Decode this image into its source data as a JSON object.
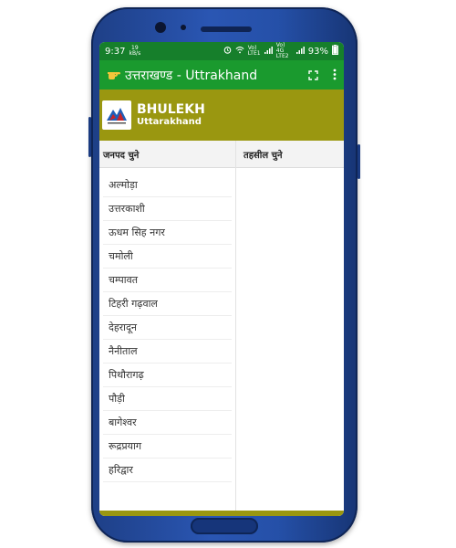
{
  "status": {
    "time": "9:37",
    "speed_value": "19",
    "speed_unit": "kB/s",
    "net1_label": "Vo) LTE1",
    "net2_label": "Vo) 4G LTE2",
    "battery": "93%"
  },
  "appbar": {
    "title": "उत्तराखण्ड - Uttrakhand"
  },
  "banner": {
    "title": "BHULEKH",
    "subtitle": "Uttarakhand"
  },
  "district_column": {
    "header": "जनपद चुने",
    "items": [
      "अल्मोड़ा",
      "उत्तरकाशी",
      "ऊधम सिह नगर",
      "चमोली",
      "चम्पावत",
      "टिहरी गढ़वाल",
      "देहरादून",
      "नैनीताल",
      "पिथौरागढ़",
      "पौड़ी",
      "बागेश्वर",
      "रूद्रप्रयाग",
      "हरिद्वार"
    ]
  },
  "tehsil_column": {
    "header": "तहसील चुने"
  },
  "colors": {
    "status_bar": "#167f2b",
    "app_bar": "#1a9a2e",
    "banner": "#9a9710",
    "phone_frame": "#2550a8"
  },
  "icons": [
    "pointing-hand-icon",
    "fullscreen-icon",
    "overflow-menu-icon",
    "wifi-icon",
    "alarm-icon",
    "battery-icon",
    "signal-icon"
  ]
}
